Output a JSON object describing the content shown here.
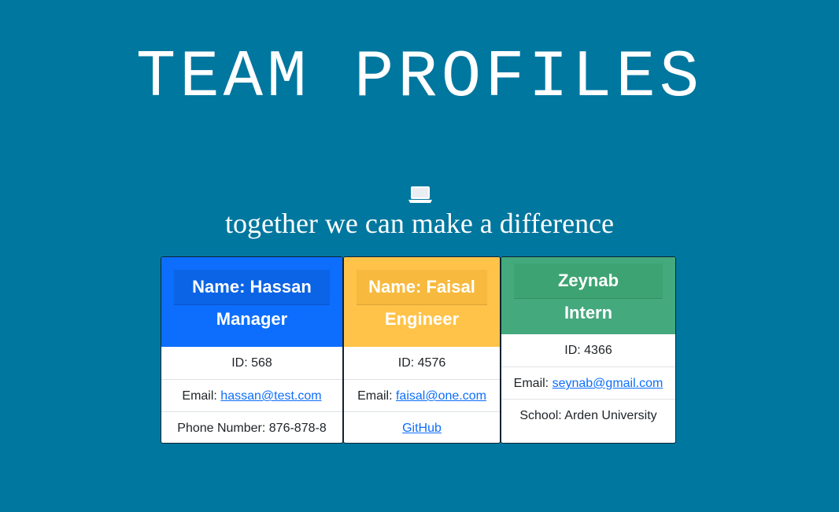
{
  "page": {
    "title": "TEAM PROFILES",
    "tagline": "together we can make a difference",
    "icon": "laptop-icon"
  },
  "colors": {
    "background": "#00779f",
    "manager": "#0d6efd",
    "engineer": "#ffc34a",
    "intern": "#44a97d"
  },
  "team": [
    {
      "name": "Name: Hassan",
      "role": "Manager",
      "id": "ID: 568",
      "email_label": "Email: ",
      "email": "hassan@test.com",
      "extra": "Phone Number: 876-878-8"
    },
    {
      "name": "Name: Faisal",
      "role": "Engineer",
      "id": "ID: 4576",
      "email_label": "Email: ",
      "email": "faisal@one.com",
      "extra": "GitHub"
    },
    {
      "name": "Zeynab",
      "role": "Intern",
      "id": "ID: 4366",
      "email_label": "Email: ",
      "email": "seynab@gmail.com",
      "extra": "School: Arden University"
    }
  ]
}
